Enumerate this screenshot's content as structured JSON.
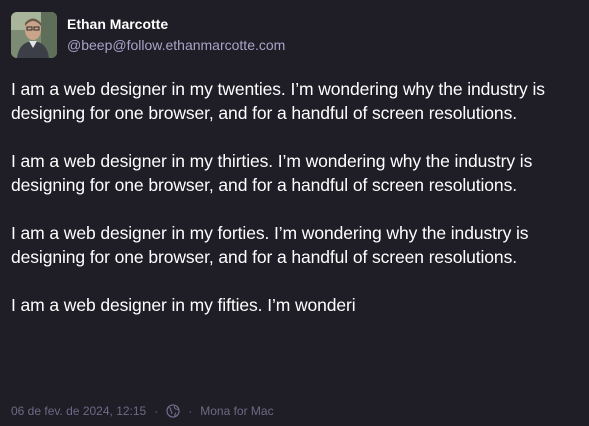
{
  "author": {
    "display_name": "Ethan Marcotte",
    "handle": "@beep@follow.ethanmarcotte.com"
  },
  "post": {
    "paragraphs": [
      "I am a web designer in my twenties. I’m wondering why the industry is designing for one browser, and for a handful of screen resolutions.",
      "I am a web designer in my thirties. I’m wondering why the industry is designing for one browser, and for a handful of screen resolutions.",
      "I am a web designer in my forties. I’m wondering why the industry is designing for one browser, and for a handful of screen resolutions.",
      "I am a web designer in my fifties. I’m wonderi"
    ]
  },
  "meta": {
    "timestamp": "06 de fev. de 2024, 12:15",
    "separator": "·",
    "visibility_icon": "globe-icon",
    "client": "Mona for Mac"
  },
  "colors": {
    "background": "#1f1d26",
    "text": "#ffffff",
    "handle": "#a7a4c7",
    "meta": "#6e6a86"
  }
}
